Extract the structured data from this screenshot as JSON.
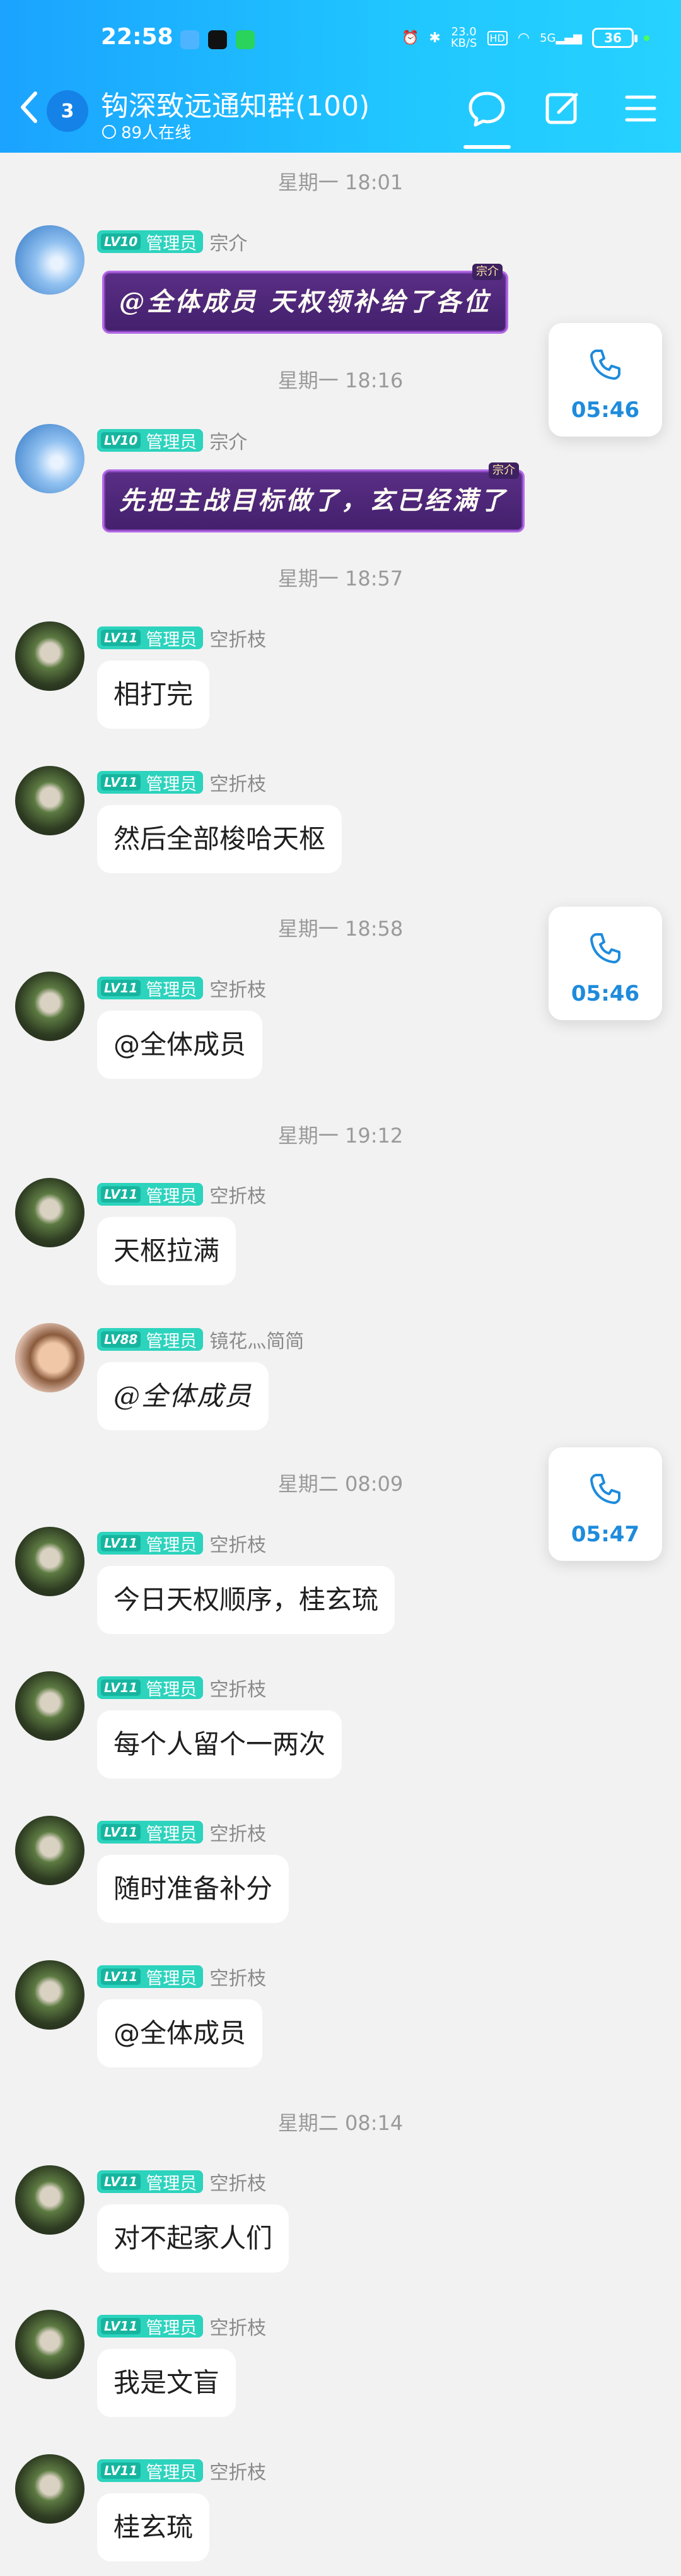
{
  "status_bar": {
    "time": "22:58",
    "net_speed": "23.0",
    "net_unit": "KB/S",
    "hd": "HD",
    "signal": "5G",
    "battery": "36"
  },
  "header": {
    "back_count": "3",
    "title": "钩深致远通知群(100)",
    "online": "89人在线"
  },
  "calls": [
    {
      "time": "05:46"
    },
    {
      "time": "05:46"
    },
    {
      "time": "05:47"
    }
  ],
  "timestamps": [
    "星期一 18:01",
    "星期一 18:16",
    "星期一 18:57",
    "星期一 18:58",
    "星期一 19:12",
    "星期二 08:09",
    "星期二 08:14"
  ],
  "messages": [
    {
      "lv": "LV10",
      "role": "管理员",
      "sender": "宗介",
      "text": "@全体成员 天权领补给了各位",
      "tag": "宗介"
    },
    {
      "lv": "LV10",
      "role": "管理员",
      "sender": "宗介",
      "text": "先把主战目标做了，玄已经满了",
      "tag": "宗介"
    },
    {
      "lv": "LV11",
      "role": "管理员",
      "sender": "空折枝",
      "text": "相打完"
    },
    {
      "lv": "LV11",
      "role": "管理员",
      "sender": "空折枝",
      "text": "然后全部梭哈天枢"
    },
    {
      "lv": "LV11",
      "role": "管理员",
      "sender": "空折枝",
      "text": "@全体成员"
    },
    {
      "lv": "LV11",
      "role": "管理员",
      "sender": "空折枝",
      "text": "天枢拉满"
    },
    {
      "lv": "LV88",
      "role": "管理员",
      "sender": "镜花灬简简",
      "text": "@全体成员"
    },
    {
      "lv": "LV11",
      "role": "管理员",
      "sender": "空折枝",
      "text": "今日天权顺序，桂玄琉"
    },
    {
      "lv": "LV11",
      "role": "管理员",
      "sender": "空折枝",
      "text": "每个人留个一两次"
    },
    {
      "lv": "LV11",
      "role": "管理员",
      "sender": "空折枝",
      "text": "随时准备补分"
    },
    {
      "lv": "LV11",
      "role": "管理员",
      "sender": "空折枝",
      "text": "@全体成员"
    },
    {
      "lv": "LV11",
      "role": "管理员",
      "sender": "空折枝",
      "text": "对不起家人们"
    },
    {
      "lv": "LV11",
      "role": "管理员",
      "sender": "空折枝",
      "text": "我是文盲"
    },
    {
      "lv": "LV11",
      "role": "管理员",
      "sender": "空折枝",
      "text": "桂玄琉"
    }
  ],
  "colors": {
    "header_start": "#1ba3ff",
    "header_end": "#26d2ff",
    "admin_badge": "#2cd3bd",
    "call_time": "#1e8bdc"
  }
}
